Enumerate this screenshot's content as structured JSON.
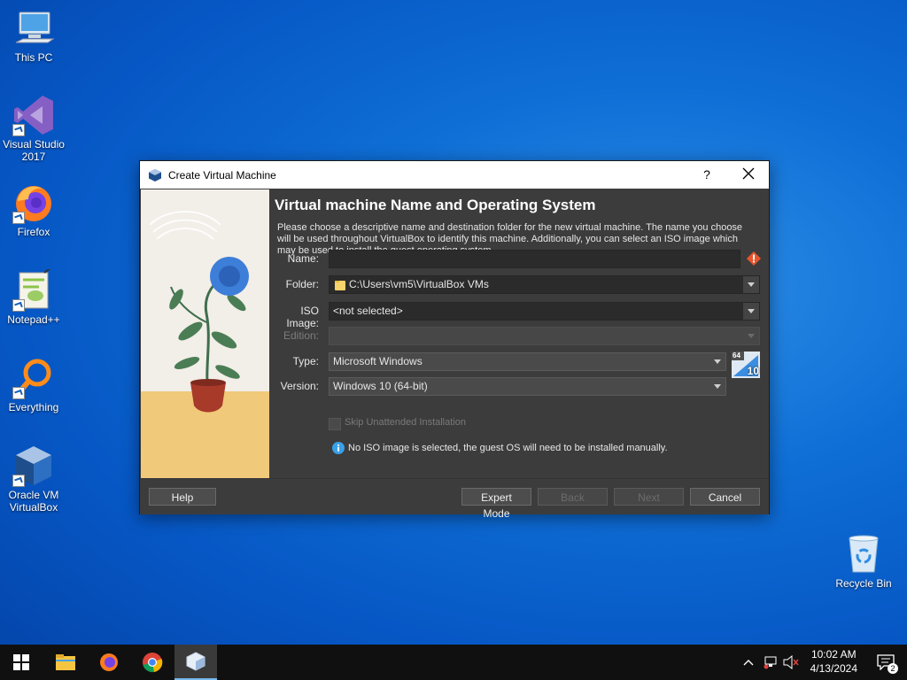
{
  "desktop": {
    "icons": [
      {
        "label": "This PC"
      },
      {
        "label": "Visual Studio 2017"
      },
      {
        "label": "Firefox"
      },
      {
        "label": "Notepad++"
      },
      {
        "label": "Everything"
      },
      {
        "label": "Oracle VM VirtualBox"
      },
      {
        "label": "Recycle Bin"
      }
    ]
  },
  "dialog": {
    "title": "Create Virtual Machine",
    "help_glyph": "?",
    "heading": "Virtual machine Name and Operating System",
    "description": "Please choose a descriptive name and destination folder for the new virtual machine. The name you choose will be used throughout VirtualBox to identify this machine. Additionally, you can select an ISO image which may be used to install the guest operating system.",
    "fields": {
      "name": {
        "label": "Name:",
        "value": ""
      },
      "folder": {
        "label": "Folder:",
        "value": "C:\\Users\\vm5\\VirtualBox VMs"
      },
      "iso": {
        "label": "ISO Image:",
        "value": "<not selected>"
      },
      "edition": {
        "label": "Edition:",
        "value": ""
      },
      "type": {
        "label": "Type:",
        "value": "Microsoft Windows"
      },
      "version": {
        "label": "Version:",
        "value": "Windows 10 (64-bit)"
      }
    },
    "os_badge": {
      "bits": "64",
      "version": "10"
    },
    "skip_unattended": {
      "label": "Skip Unattended Installation",
      "checked": false
    },
    "info_message": "No ISO image is selected, the guest OS will need to be installed manually.",
    "buttons": {
      "help": "Help",
      "expert": "Expert Mode",
      "back": "Back",
      "next": "Next",
      "cancel": "Cancel"
    }
  },
  "taskbar": {
    "apps": [
      "start-icon",
      "file-explorer-icon",
      "firefox-icon",
      "chrome-icon",
      "virtualbox-icon"
    ],
    "time": "10:02 AM",
    "date": "4/13/2024",
    "notification_count": "2"
  },
  "colors": {
    "dialog_bg": "#3c3c3c",
    "warning": "#e8542c",
    "accent": "#76b9ed"
  }
}
